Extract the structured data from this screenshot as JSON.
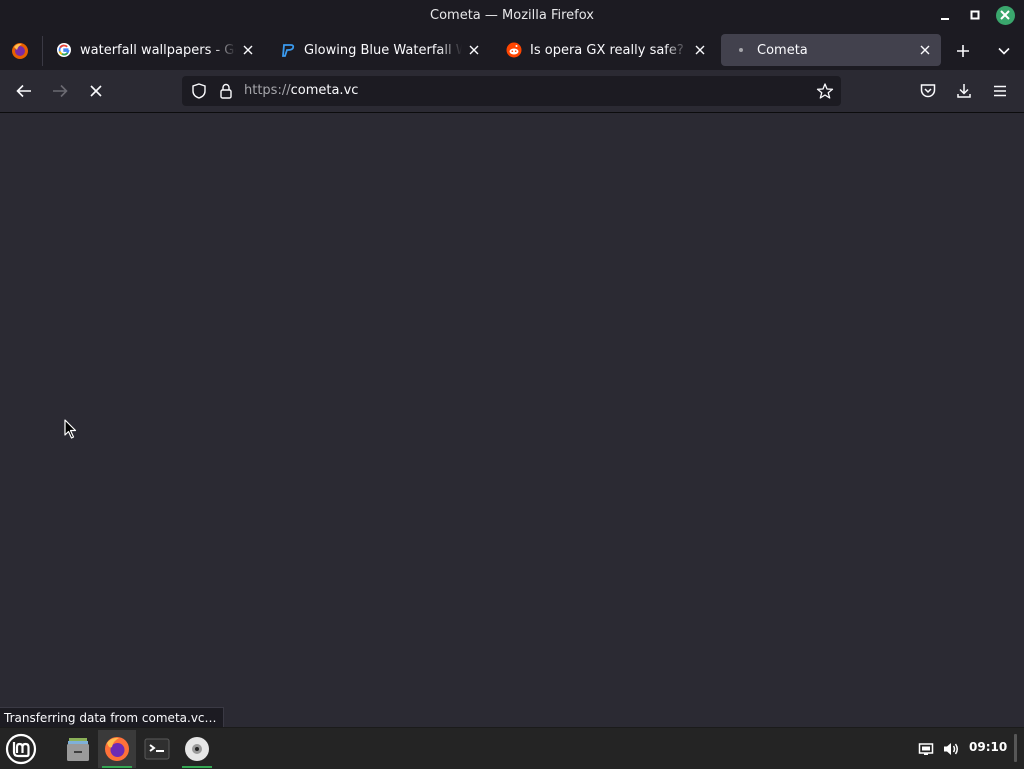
{
  "window": {
    "title": "Cometa — Mozilla Firefox"
  },
  "tabs": [
    {
      "title": "waterfall wallpapers - Google",
      "icon": "google-icon",
      "active": false
    },
    {
      "title": "Glowing Blue Waterfall Wallpapers",
      "icon": "wallpaper-site-icon",
      "active": false
    },
    {
      "title": "Is opera GX really safe? : r/Opera",
      "icon": "reddit-icon",
      "active": false
    },
    {
      "title": "Cometa",
      "icon": "loading-dot-icon",
      "active": true
    }
  ],
  "urlbar": {
    "scheme": "https://",
    "host": "cometa.vc"
  },
  "status": {
    "text": "Transferring data from cometa.vc…"
  },
  "taskbar": {
    "items": [
      "mint-menu-icon",
      "files-icon",
      "firefox-icon",
      "terminal-icon",
      "disc-icon"
    ],
    "clock": "09:10"
  },
  "colors": {
    "accent_green": "#35a854",
    "close_green": "#3aa76d",
    "content_bg": "#2b2a33",
    "chrome_bg": "#1c1b22"
  }
}
